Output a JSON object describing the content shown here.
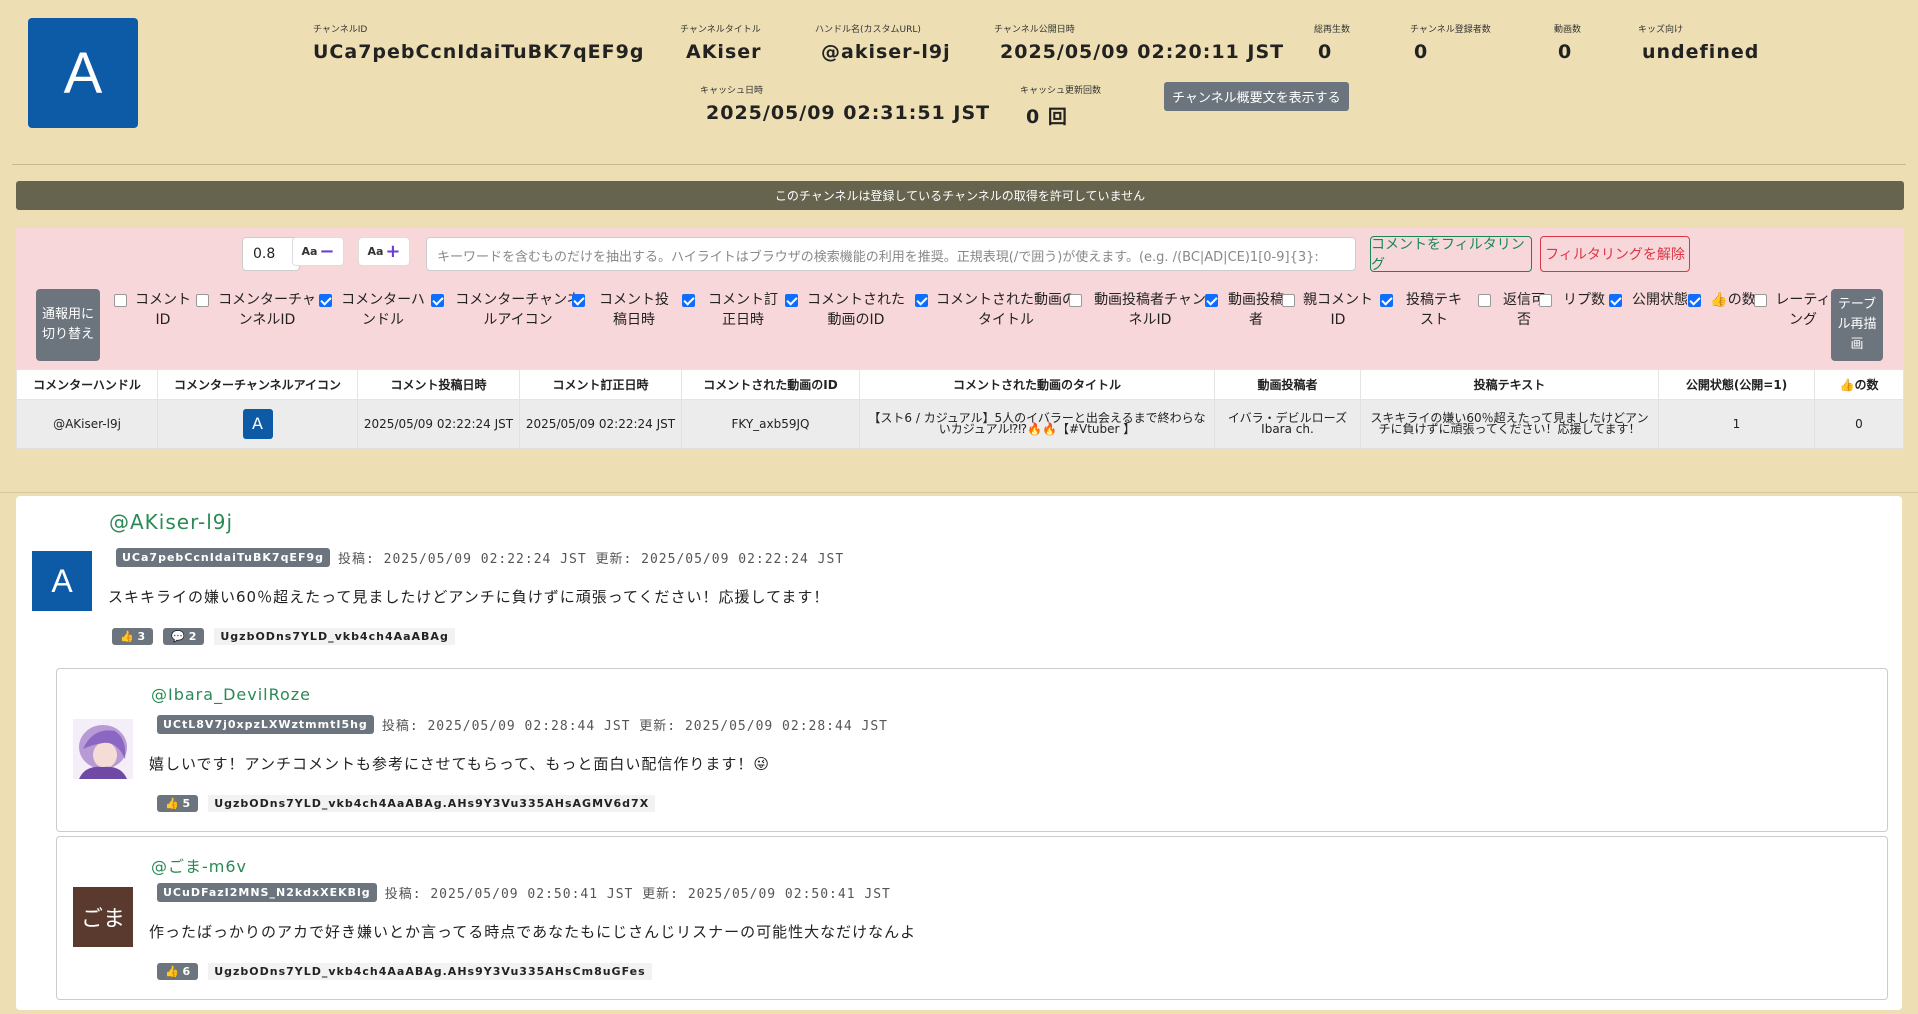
{
  "channel": {
    "avatar_letter": "A",
    "id_label": "チャンネルID",
    "id": "UCa7pebCcnIdaiTuBK7qEF9g",
    "title_label": "チャンネルタイトル",
    "title": "AKiser",
    "handle_label": "ハンドル名(カスタムURL)",
    "handle": "@akiser-l9j",
    "published_label": "チャンネル公開日時",
    "published": "2025/05/09 02:20:11 JST",
    "views_label": "総再生数",
    "views": "0",
    "subs_label": "チャンネル登録者数",
    "subs": "0",
    "videos_label": "動画数",
    "videos": "0",
    "kids_label": "キッズ向け",
    "kids": "undefined",
    "cache_label": "キャッシュ日時",
    "cache": "2025/05/09 02:31:51 JST",
    "cache_count_label": "キャッシュ更新回数",
    "cache_count": "0 回",
    "desc_button": "チャンネル概要文を表示する"
  },
  "banner": "このチャンネルは登録しているチャンネルの取得を許可していません",
  "toolbar": {
    "zoom": "0.8",
    "zoom_out_label": "Aa",
    "zoom_in_label": "Aa",
    "search_placeholder": "キーワードを含むものだけを抽出する。ハイライトはブラウザの検索機能の利用を推奨。正規表現(/で囲う)が使えます。(e.g. /(BC|AD|CE)1[0-9]{3}:",
    "filter_btn": "コメントをフィルタリング",
    "clear_btn": "フィルタリングを解除",
    "toggle_btn": "通報用に切り替え",
    "redraw_btn": "テーブル再描画"
  },
  "columns": [
    {
      "label": "コメントID",
      "checked": false
    },
    {
      "label": "コメンターチャンネルID",
      "checked": false
    },
    {
      "label": "コメンターハンドル",
      "checked": true
    },
    {
      "label": "コメンターチャンネルアイコン",
      "checked": true
    },
    {
      "label": "コメント投稿日時",
      "checked": true
    },
    {
      "label": "コメント訂正日時",
      "checked": true
    },
    {
      "label": "コメントされた動画のID",
      "checked": true
    },
    {
      "label": "コメントされた動画のタイトル",
      "checked": true
    },
    {
      "label": "動画投稿者チャンネルID",
      "checked": false
    },
    {
      "label": "動画投稿者",
      "checked": true
    },
    {
      "label": "親コメントID",
      "checked": false
    },
    {
      "label": "投稿テキスト",
      "checked": true
    },
    {
      "label": "返信可否",
      "checked": false
    },
    {
      "label": "リプ数",
      "checked": false
    },
    {
      "label": "公開状態",
      "checked": true
    },
    {
      "label": "👍の数",
      "checked": true
    },
    {
      "label": "レーティング",
      "checked": false
    }
  ],
  "table": {
    "headers": [
      "コメンターハンドル",
      "コメンターチャンネルアイコン",
      "コメント投稿日時",
      "コメント訂正日時",
      "コメントされた動画のID",
      "コメントされた動画のタイトル",
      "動画投稿者",
      "投稿テキスト",
      "公開状態(公開=1)",
      "👍の数"
    ],
    "row": {
      "handle": "@AKiser-l9j",
      "icon": "A",
      "posted": "2025/05/09 02:22:24 JST",
      "edited": "2025/05/09 02:22:24 JST",
      "video_id": "FKY_axb59JQ",
      "video_title": "【スト6 / カジュアル】5人のイバラーと出会えるまで終わらないカジュアル⁉⁉🔥🔥【#Vtuber 】",
      "uploader": "イバラ・デビルローズ Ibara ch.",
      "text": "スキキライの嫌い60％超えたって見ましたけどアンチに負けずに頑張ってください！応援してます！",
      "public": "1",
      "likes": "0"
    }
  },
  "comments": {
    "main": {
      "handle": "@AKiser-l9j",
      "channel_id": "UCa7pebCcnIdaiTuBK7qEF9g",
      "meta": "投稿: 2025/05/09 02:22:24 JST 更新: 2025/05/09 02:22:24 JST",
      "text": "スキキライの嫌い60％超えたって見ましたけどアンチに負けずに頑張ってください！応援してます！",
      "likes": "👍 3",
      "replies": "💬 2",
      "comment_id": "UgzbODns7YLD_vkb4ch4AaABAg",
      "avatar": "A"
    },
    "reply1": {
      "handle": "@Ibara_DevilRoze",
      "channel_id": "UCtL8V7j0xpzLXWztmmtI5hg",
      "meta": "投稿: 2025/05/09 02:28:44 JST 更新: 2025/05/09 02:28:44 JST",
      "text": "嬉しいです！アンチコメントも参考にさせてもらって、もっと面白い配信作ります！😜",
      "likes": "👍 5",
      "comment_id": "UgzbODns7YLD_vkb4ch4AaABAg.AHs9Y3Vu335AHsAGMV6d7X"
    },
    "reply2": {
      "handle": "@ごま-m6v",
      "channel_id": "UCuDFazI2MNS_N2kdxXEKBlg",
      "meta": "投稿: 2025/05/09 02:50:41 JST 更新: 2025/05/09 02:50:41 JST",
      "text": "作ったばっかりのアカで好き嫌いとか言ってる時点であなたもにじさんじリスナーの可能性大なだけなんよ",
      "likes": "👍 6",
      "comment_id": "UgzbODns7YLD_vkb4ch4AaABAg.AHs9Y3Vu335AHsCm8uGFes",
      "avatar_text": "ごま"
    }
  }
}
